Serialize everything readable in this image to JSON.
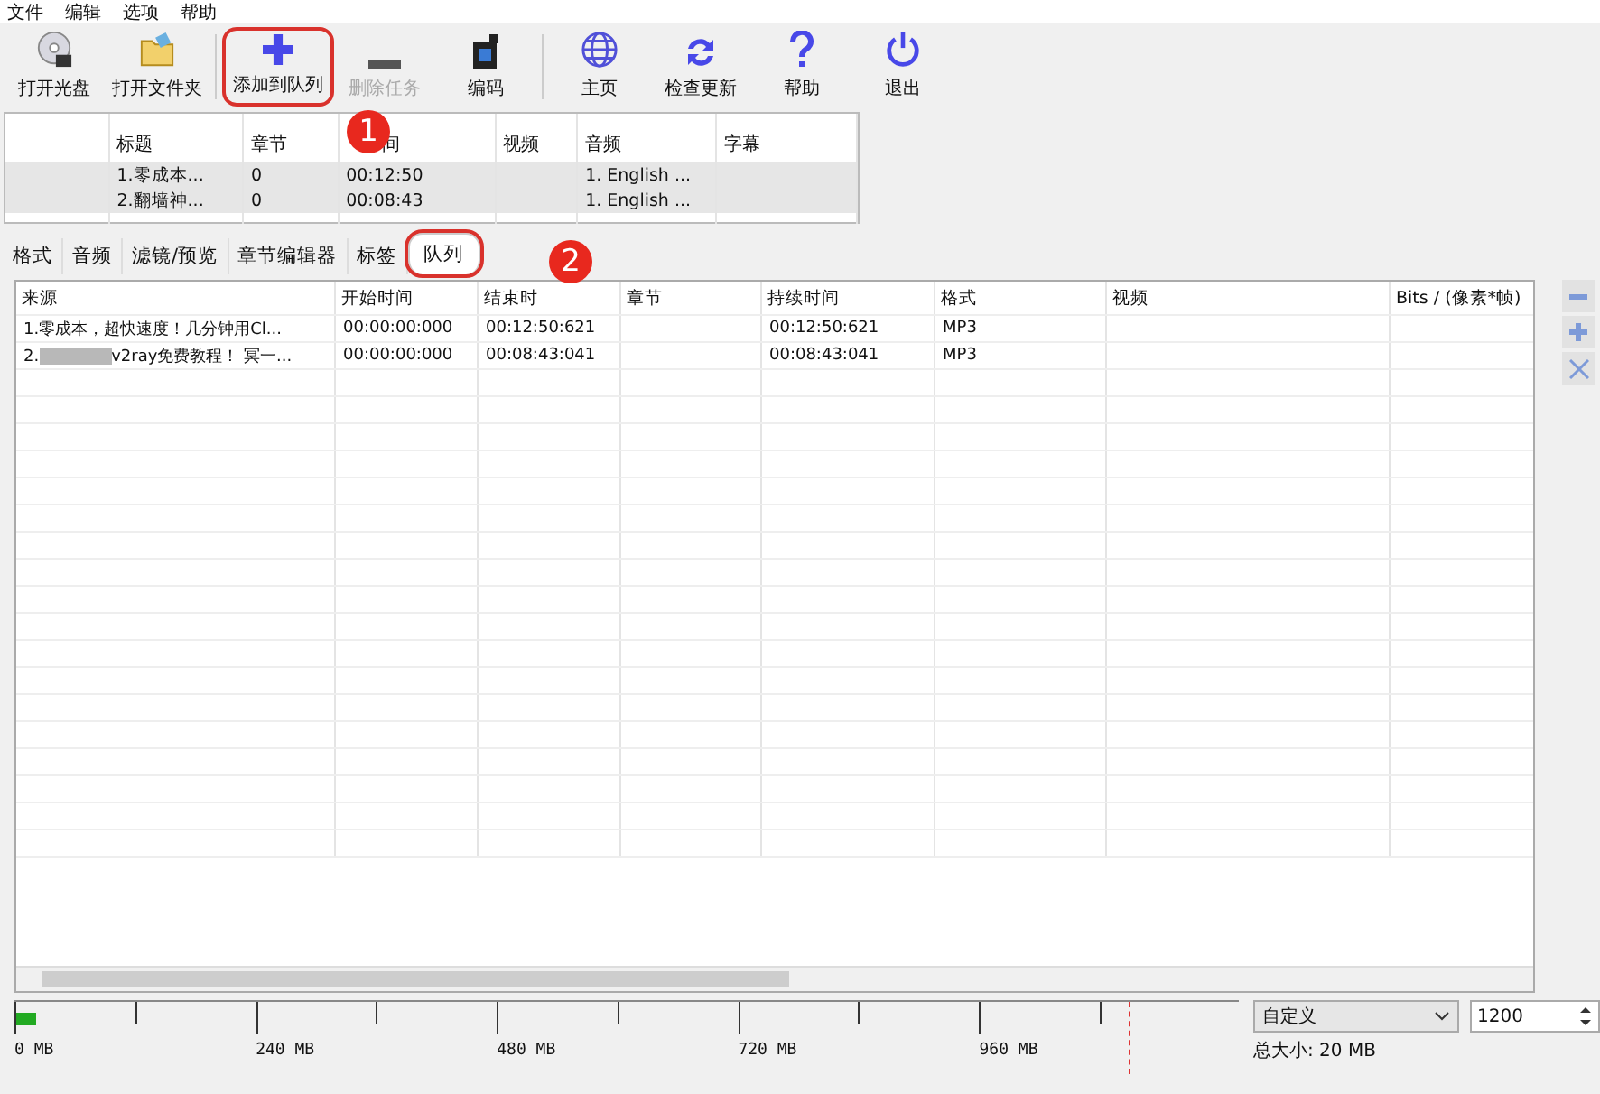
{
  "menu": [
    "文件",
    "编辑",
    "选项",
    "帮助"
  ],
  "toolbar_groups": [
    [
      {
        "label": "打开光盘",
        "kind": "disc",
        "disabled": false,
        "highlighted": false
      },
      {
        "label": "打开文件夹",
        "kind": "folder",
        "disabled": false,
        "highlighted": false
      }
    ],
    [
      {
        "label": "添加到队列",
        "kind": "add",
        "disabled": false,
        "highlighted": true
      },
      {
        "label": "删除任务",
        "kind": "remove",
        "disabled": true,
        "highlighted": false
      },
      {
        "label": "编码",
        "kind": "encode",
        "disabled": false,
        "highlighted": false
      }
    ],
    [
      {
        "label": "主页",
        "kind": "home",
        "disabled": false,
        "highlighted": false
      },
      {
        "label": "检查更新",
        "kind": "update",
        "disabled": false,
        "highlighted": false
      },
      {
        "label": "帮助",
        "kind": "help",
        "disabled": false,
        "highlighted": false
      },
      {
        "label": "退出",
        "kind": "exit",
        "disabled": false,
        "highlighted": false
      }
    ]
  ],
  "titles_table": {
    "columns": [
      "",
      "标题",
      "章节",
      "间",
      "视频",
      "音频",
      "字幕"
    ],
    "rows": [
      {
        "selected": true,
        "cells": [
          "",
          "1.零成本...",
          "0",
          "00:12:50",
          "",
          "1. English ...",
          ""
        ]
      },
      {
        "selected": true,
        "cells": [
          "",
          "2.翻墙神...",
          "0",
          "00:08:43",
          "",
          "1. English ...",
          ""
        ]
      }
    ]
  },
  "tabs": [
    {
      "label": "格式",
      "selected": false,
      "highlighted": false
    },
    {
      "label": "音频",
      "selected": false,
      "highlighted": false
    },
    {
      "label": "滤镜/预览",
      "selected": false,
      "highlighted": false
    },
    {
      "label": "章节编辑器",
      "selected": false,
      "highlighted": false
    },
    {
      "label": "标签",
      "selected": false,
      "highlighted": false
    },
    {
      "label": "队列",
      "selected": true,
      "highlighted": true
    }
  ],
  "queue": {
    "source_column": "来源",
    "columns": [
      "开始时间",
      "结束时",
      "章节",
      "持续时间",
      "格式",
      "视频",
      "Bits / (像素*帧)"
    ],
    "rows": [
      {
        "source": [
          {
            "kind": "text",
            "text": "1.零成本，超快速度！几分钟用Cl..."
          }
        ],
        "cells": [
          "00:00:00:000",
          "00:12:50:621",
          "",
          "00:12:50:621",
          "MP3",
          "",
          ""
        ]
      },
      {
        "source": [
          {
            "kind": "text",
            "text": "2."
          },
          {
            "kind": "redaction"
          },
          {
            "kind": "text",
            "text": "v2ray免费教程！ 冥一..."
          }
        ],
        "cells": [
          "00:00:00:000",
          "00:08:43:041",
          "",
          "00:08:43:041",
          "MP3",
          "",
          ""
        ]
      }
    ]
  },
  "side_buttons": [
    {
      "kind": "remove"
    },
    {
      "kind": "add"
    },
    {
      "kind": "clear"
    }
  ],
  "size_meter": {
    "level": 0.017,
    "ticks": [
      "0 MB",
      "240 MB",
      "480 MB",
      "720 MB",
      "960 MB"
    ]
  },
  "target": {
    "preset": "自定义",
    "value": "1200",
    "total": "总大小: 20 MB"
  },
  "callouts": [
    "1",
    "2"
  ]
}
